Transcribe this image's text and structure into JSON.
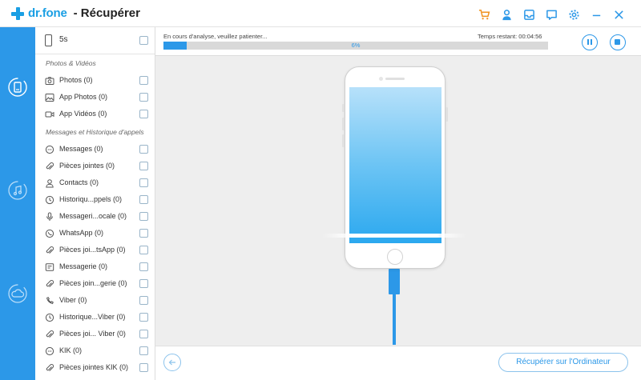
{
  "app": {
    "brand": "dr.fone",
    "title": "- Récupérer"
  },
  "titlebar_icons": [
    "cart-icon",
    "user-icon",
    "inbox-icon",
    "feedback-icon",
    "settings-icon",
    "minimize-icon",
    "close-icon"
  ],
  "nav": [
    "phone-recover-icon",
    "music-transfer-icon",
    "cloud-recover-icon"
  ],
  "device": {
    "name": "5s"
  },
  "sections": {
    "photos": "Photos & Vidéos",
    "messages": "Messages et Historique d'appels"
  },
  "photo_items": [
    {
      "icon": "camera-icon",
      "label": "Photos (0)"
    },
    {
      "icon": "image-icon",
      "label": "App Photos (0)"
    },
    {
      "icon": "video-icon",
      "label": "App Vidéos (0)"
    }
  ],
  "message_items": [
    {
      "icon": "chat-bubble-icon",
      "label": "Messages (0)"
    },
    {
      "icon": "paperclip-icon",
      "label": "Pièces jointes (0)"
    },
    {
      "icon": "contact-icon",
      "label": "Contacts (0)"
    },
    {
      "icon": "clock-icon",
      "label": "Historiqu...ppels (0)"
    },
    {
      "icon": "microphone-icon",
      "label": "Messageri...ocale (0)"
    },
    {
      "icon": "phone-icon",
      "label": "WhatsApp (0)"
    },
    {
      "icon": "paperclip-icon",
      "label": "Pièces joi...tsApp (0)"
    },
    {
      "icon": "message-square-icon",
      "label": "Messagerie (0)"
    },
    {
      "icon": "paperclip-icon",
      "label": "Pièces join...gerie  (0)"
    },
    {
      "icon": "viber-icon",
      "label": "Viber (0)"
    },
    {
      "icon": "clock-icon",
      "label": "Historique...Viber (0)"
    },
    {
      "icon": "paperclip-icon",
      "label": "Pièces joi... Viber (0)"
    },
    {
      "icon": "kik-icon",
      "label": "KIK (0)"
    },
    {
      "icon": "paperclip-icon",
      "label": "Pièces jointes KIK (0)"
    }
  ],
  "scan": {
    "status": "En cours d'analyse, veuillez patienter...",
    "remaining": "Temps restant: 00:04:56",
    "progress_label": "6%",
    "progress": 0.06
  },
  "actions": {
    "recover_label": "Récupérer sur l'Ordinateur"
  },
  "colors": {
    "accent": "#2c98e8",
    "brand": "#1a9fe4",
    "cart": "#f0921e"
  }
}
